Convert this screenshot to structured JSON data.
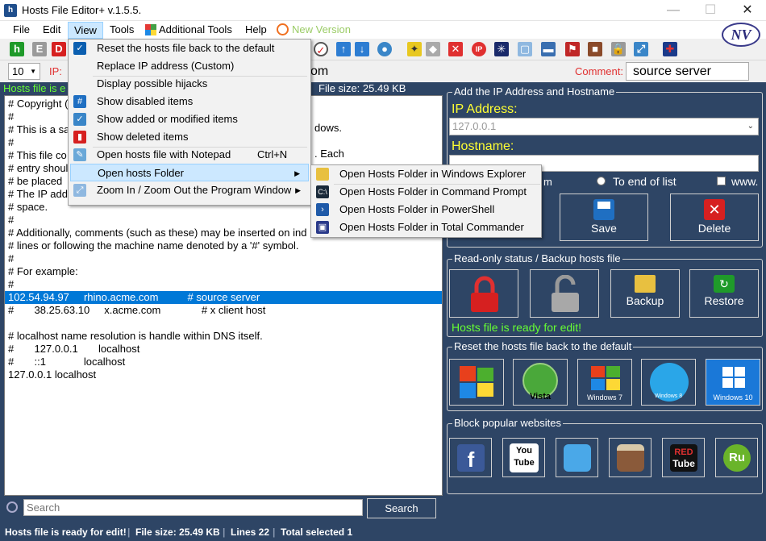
{
  "window": {
    "title": "Hosts File Editor+ v.1.5.5.",
    "minimize": "—",
    "maximize": "☐",
    "close": "✕",
    "logo": "NV"
  },
  "menubar": {
    "file": "File",
    "edit": "Edit",
    "view": "View",
    "tools": "Tools",
    "additional_tools": "Additional Tools",
    "help": "Help",
    "new_version": "New Version"
  },
  "comment_row": {
    "line_select": "10",
    "ip_label": "IP:",
    "hostname_fragment": "om",
    "comment_label": "Comment:",
    "comment_value": "source server"
  },
  "editor": {
    "status": "Hosts file is e",
    "file_size": "File size: 25.49 KB",
    "lines": [
      "# Copyright (",
      "#",
      "# This is a sa",
      "#",
      "# This file co",
      "# entry shoul",
      "# be placed",
      "# The IP add",
      "# space.",
      "#",
      "# Additionally, comments (such as these) may be inserted on ind",
      "# lines or following the machine name denoted by a '#' symbol.",
      "#",
      "# For example:",
      "#",
      "102.54.94.97     rhino.acme.com          # source server",
      "#       38.25.63.10     x.acme.com              # x client host",
      "",
      "# localhost name resolution is handle within DNS itself.",
      "#       127.0.0.1       localhost",
      "#       ::1             localhost",
      "127.0.0.1 localhost"
    ],
    "right_fragments": {
      "l3": "dows.",
      "l5": ". Each"
    }
  },
  "view_menu": {
    "items": [
      {
        "label": "Reset the hosts file back to the default",
        "shortcut": ""
      },
      {
        "label": "Replace IP address (Custom)",
        "shortcut": ""
      },
      {
        "label": "Display possible hijacks",
        "shortcut": ""
      },
      {
        "label": "Show disabled items",
        "shortcut": ""
      },
      {
        "label": "Show added or modified items",
        "shortcut": ""
      },
      {
        "label": "Show deleted items",
        "shortcut": ""
      },
      {
        "label": "Open hosts file with Notepad",
        "shortcut": "Ctrl+N"
      },
      {
        "label": "Open hosts Folder",
        "shortcut": ""
      },
      {
        "label": "Zoom In / Zoom Out the Program Window",
        "shortcut": ""
      }
    ]
  },
  "hosts_folder_submenu": {
    "items": [
      "Open Hosts Folder in Windows Explorer",
      "Open Hosts Folder in Command Prompt",
      "Open Hosts Folder in PowerShell",
      "Open Hosts Folder in Total Commander"
    ]
  },
  "add_panel": {
    "title": "Add the IP Address  and Hostname",
    "ip_label": "IP Address:",
    "ip_value": "127.0.0.1",
    "hostname_label": "Hostname:",
    "hostname_value": "",
    "partial_radio": "m",
    "radio_end": "To end of list",
    "www_label": "www.",
    "save": "Save",
    "delete": "Delete"
  },
  "readonly_panel": {
    "title": "Read-only status / Backup hosts file",
    "backup": "Backup",
    "restore": "Restore",
    "status": "Hosts file is ready for edit!"
  },
  "reset_panel": {
    "title": "Reset the hosts file back to the default",
    "vista": "Vista",
    "win7": "Windows 7",
    "win8": "Windows 8",
    "win10": "Windows 10"
  },
  "block_panel": {
    "title": "Block popular websites",
    "youtube": "You Tube",
    "redtube_red": "RED",
    "redtube_tube": "Tube",
    "rutube": "Ru"
  },
  "search": {
    "placeholder": "Search",
    "button": "Search"
  },
  "statusbar": {
    "ready": "Hosts file is ready for edit!",
    "size": "File size:  25.49 KB",
    "lines": "Lines 22",
    "selected": "Total selected 1"
  },
  "colors": {
    "panel_bg": "#2e4565",
    "accent_green": "#66ff33",
    "accent_yellow": "#ffff33",
    "selection": "#0078d7"
  }
}
